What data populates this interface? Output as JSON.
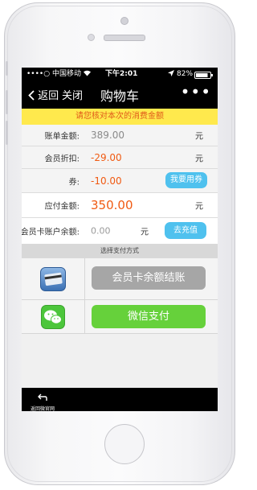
{
  "status_bar": {
    "carrier": "••••○ 中国移动",
    "time": "下午2:01",
    "battery": "82%"
  },
  "nav": {
    "back_label": "返回",
    "close_label": "关闭",
    "title": "购物车",
    "more_label": "•••"
  },
  "notice": "请您核对本次的消费金额",
  "rows": {
    "bill": {
      "label": "账单金额:",
      "value": "389.00",
      "unit": "元"
    },
    "discount": {
      "label": "会员折扣:",
      "value": "-29.00",
      "unit": "元"
    },
    "coupon": {
      "label": "券:",
      "value": "-10.00",
      "button": "我要用券"
    },
    "payable": {
      "label": "应付金额:",
      "value": "350.00",
      "unit": "元"
    },
    "balance": {
      "label": "会员卡账户余额:",
      "value": "0.00",
      "unit": "元",
      "button": "去充值"
    }
  },
  "pay_section": {
    "title": "选择支付方式",
    "card_button": "会员卡余额结账",
    "wechat_button": "微信支付"
  },
  "bottom": {
    "back_home_label": "返回微官网"
  },
  "colors": {
    "orange": "#f05a12",
    "blue_button": "#4fc1ee",
    "gray_button": "#a6a6a6",
    "green_button": "#66d13b",
    "notice_bg": "#ffe94d"
  }
}
